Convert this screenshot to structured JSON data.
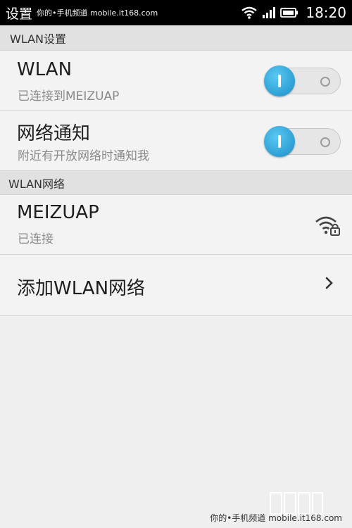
{
  "status_bar": {
    "title": "设置",
    "watermark": "你的•手机频道  mobile.it168.com",
    "time": "18:20"
  },
  "sections": {
    "wlan_settings": "WLAN设置",
    "wlan_networks": "WLAN网络"
  },
  "rows": {
    "wlan": {
      "title": "WLAN",
      "subtitle": "已连接到MEIZUAP",
      "toggle_on": true
    },
    "notify": {
      "title": "网络通知",
      "subtitle": "附近有开放网络时通知我",
      "toggle_on": true
    },
    "network": {
      "title": "MEIZUAP",
      "subtitle": "已连接",
      "icon": "wifi-lock-icon"
    },
    "add": {
      "title": "添加WLAN网络",
      "icon": "chevron-right-icon"
    }
  },
  "footer": {
    "watermark": "你的•手机频道  mobile.it168.com"
  },
  "colors": {
    "toggle_accent": "#1a8ec8",
    "background": "#efefef",
    "section_header": "#e1e1e1"
  }
}
